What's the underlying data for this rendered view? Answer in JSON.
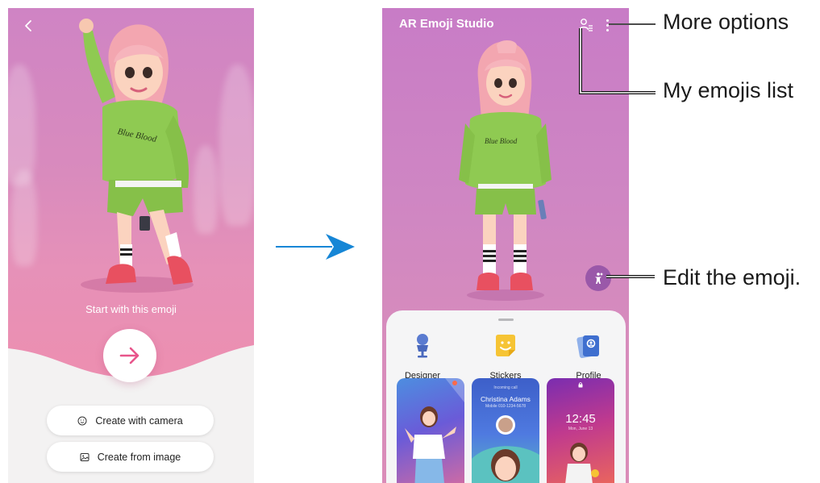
{
  "left_screen": {
    "back_icon": "chevron-left-icon",
    "start_text": "Start with this emoji",
    "next_icon": "arrow-right-icon",
    "buttons": [
      {
        "label": "Create with camera",
        "icon": "face-icon"
      },
      {
        "label": "Create from image",
        "icon": "image-icon"
      }
    ],
    "accent_color": "#e8558b"
  },
  "flow_arrow": {
    "icon": "arrow-right-icon",
    "color": "#1686d6"
  },
  "right_screen": {
    "title": "AR Emoji Studio",
    "header_icons": [
      "my-emojis-icon",
      "more-options-icon"
    ],
    "edit_icon": "person-edit-icon",
    "menu_items": [
      {
        "label": "Designer",
        "icon": "designer-icon"
      },
      {
        "label": "Stickers",
        "icon": "stickers-icon"
      },
      {
        "label": "Profile",
        "icon": "profile-icon"
      }
    ],
    "thumbnails": {
      "call_label": "Incoming call",
      "call_name": "Christina Adams",
      "call_number": "Mobile 010-1234-5678",
      "lock_time": "12:45",
      "lock_date": "Mon, June 13"
    }
  },
  "callouts": {
    "more_options": "More options",
    "my_emojis_list": "My emojis list",
    "edit_emoji": "Edit the emoji."
  }
}
